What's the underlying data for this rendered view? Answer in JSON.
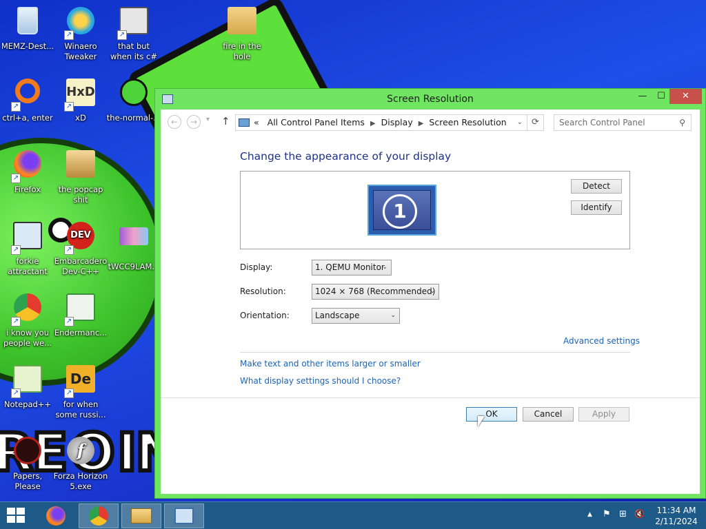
{
  "desktop": {
    "icons": [
      {
        "label": "MEMZ-Dest...",
        "icon": "recycle-bin-icon"
      },
      {
        "label": "Winaero Tweaker",
        "icon": "winaero-icon"
      },
      {
        "label": "that but when its c#",
        "icon": "windows-stack-icon"
      },
      {
        "label": "fire in the hole",
        "icon": "folder-icon"
      },
      {
        "label": "ctrl+a, enter",
        "icon": "ring-icon"
      },
      {
        "label": "xD",
        "icon": "hxd-icon"
      },
      {
        "label": "the-normal-...",
        "icon": "green-face-icon"
      },
      {
        "label": "Firefox",
        "icon": "firefox-icon"
      },
      {
        "label": "the popcap shit",
        "icon": "popcap-icon"
      },
      {
        "label": "forkie attractant",
        "icon": "monitor-gear-icon"
      },
      {
        "label": "Embarcadero Dev-C++",
        "icon": "devcpp-icon"
      },
      {
        "label": "tWCC9LAM...",
        "icon": "image-thumbnail-icon"
      },
      {
        "label": "i know you people we...",
        "icon": "chrome-icon"
      },
      {
        "label": "Endermanc...",
        "icon": "app-window-icon"
      },
      {
        "label": "Notepad++",
        "icon": "notepad-plus-plus-icon"
      },
      {
        "label": "for when some russi...",
        "icon": "de-icon"
      },
      {
        "label": "Papers, Please",
        "icon": "papers-please-icon"
      },
      {
        "label": "Forza Horizon 5.exe",
        "icon": "flash-icon"
      }
    ]
  },
  "window": {
    "title": "Screen Resolution",
    "controls": {
      "minimize": "—",
      "maximize": "☐",
      "close": "✕"
    }
  },
  "nav": {
    "back": "←",
    "forward": "→",
    "recent": "▾",
    "up": "↑",
    "breadcrumb_prefix": "«",
    "breadcrumb": [
      "All Control Panel Items",
      "Display",
      "Screen Resolution"
    ],
    "separator": "▶",
    "dropdown": "⌄",
    "refresh": "⟳",
    "search_placeholder": "Search Control Panel",
    "search_glyph": "⚲"
  },
  "content": {
    "heading": "Change the appearance of your display",
    "monitor_number": "1",
    "detect_label": "Detect",
    "identify_label": "Identify",
    "display_label": "Display:",
    "display_value": "1. QEMU Monitor",
    "resolution_label": "Resolution:",
    "resolution_value": "1024 × 768 (Recommended)",
    "orientation_label": "Orientation:",
    "orientation_value": "Landscape",
    "select_arrow": "⌄",
    "advanced_link": "Advanced settings",
    "link_text_size": "Make text and other items larger or smaller",
    "link_help": "What display settings should I choose?"
  },
  "footer": {
    "ok": "OK",
    "cancel": "Cancel",
    "apply": "Apply"
  },
  "taskbar": {
    "apps": [
      "firefox",
      "chrome",
      "file-explorer",
      "control-panel"
    ],
    "tray": {
      "chevron": "▲",
      "flag": "⚑",
      "network": "⊞",
      "volume": "🔇"
    },
    "time": "11:34 AM",
    "date": "2/11/2024"
  },
  "colors": {
    "window_frame": "#6fe561",
    "close": "#c7504b",
    "link": "#1a63b8",
    "heading": "#1e3287",
    "taskbar": "#1e5a88"
  }
}
